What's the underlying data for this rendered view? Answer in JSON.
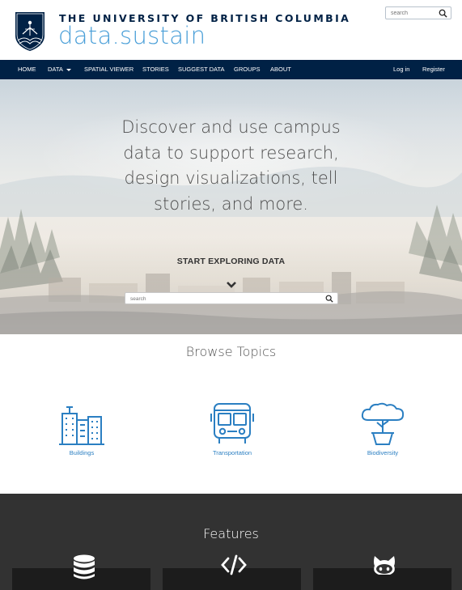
{
  "header": {
    "logo_text": "UBC",
    "university_title": "THE UNIVERSITY OF BRITISH COLUMBIA",
    "site_name": "data.sustain",
    "search_placeholder": "search"
  },
  "nav": {
    "items": [
      {
        "label": "HOME"
      },
      {
        "label": "DATA"
      },
      {
        "label": "SPATIAL VIEWER"
      },
      {
        "label": "STORIES"
      },
      {
        "label": "SUGGEST DATA"
      },
      {
        "label": "GROUPS"
      },
      {
        "label": "ABOUT"
      }
    ],
    "login": "Log in",
    "register": "Register"
  },
  "hero": {
    "lines": [
      "Discover and use campus",
      "data to support research,",
      "design visualizations, tell",
      "stories, and more."
    ],
    "cta": "START EXPLORING DATA",
    "search_placeholder": "search"
  },
  "browse": {
    "title": "Browse Topics",
    "topics": [
      {
        "label": "Buildings",
        "icon": "buildings-icon"
      },
      {
        "label": "Transportation",
        "icon": "bus-icon"
      },
      {
        "label": "Biodiversity",
        "icon": "tree-icon"
      }
    ]
  },
  "features": {
    "title": "Features",
    "icons": [
      "database-icon",
      "code-icon",
      "github-icon"
    ]
  },
  "colors": {
    "navy": "#002145",
    "accent_blue": "#2b7fc2",
    "brand_blue": "#4a9fd8",
    "features_bg": "#323232"
  }
}
